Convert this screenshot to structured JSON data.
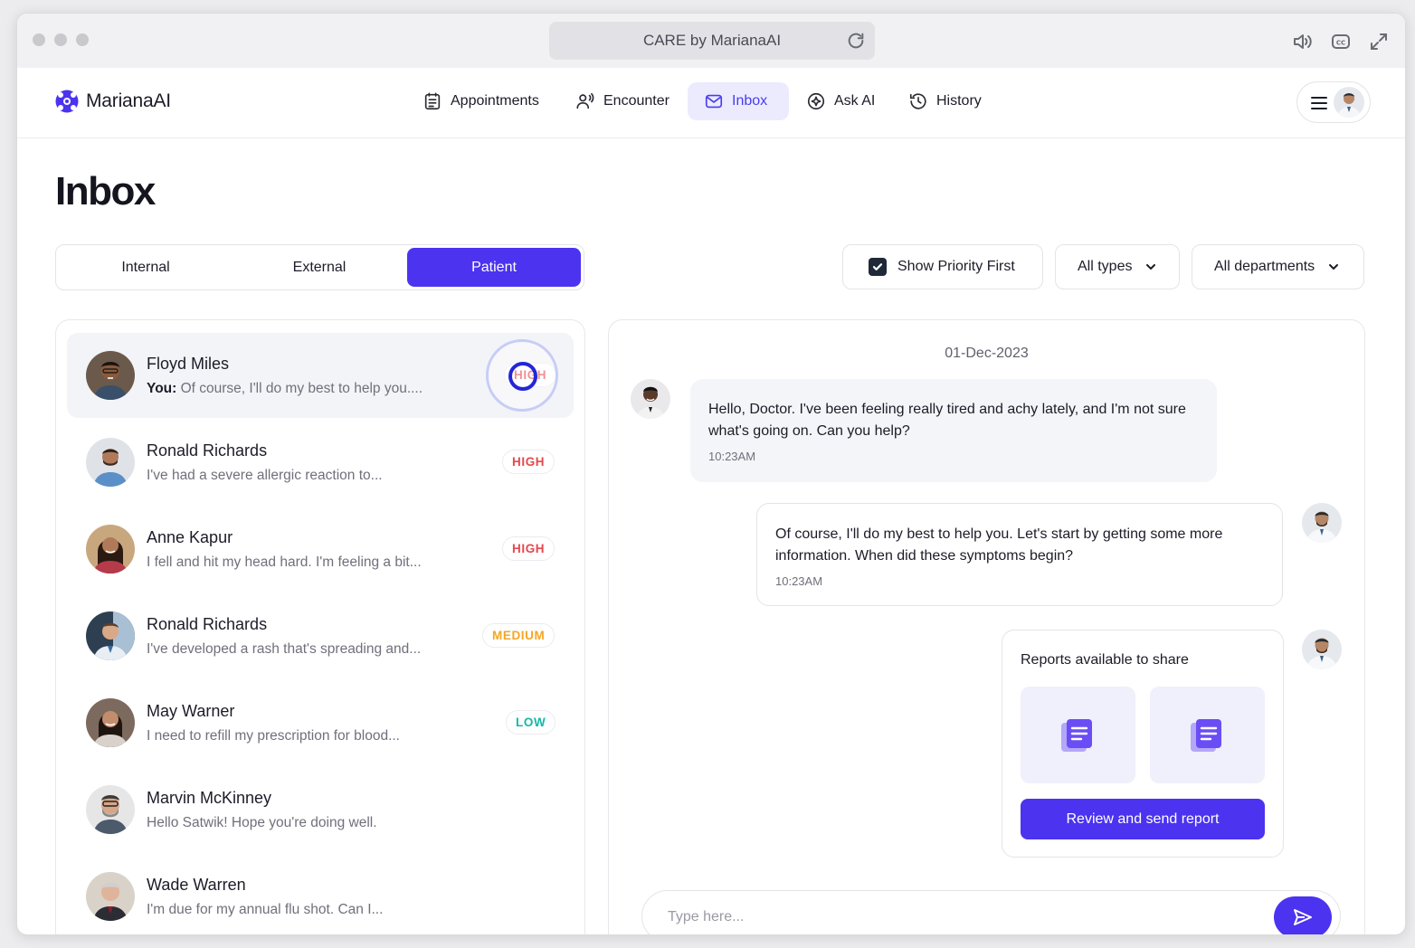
{
  "window": {
    "title": "CARE by MarianaAI"
  },
  "brand": {
    "name": "MarianaAI"
  },
  "nav": {
    "appointments": "Appointments",
    "encounter": "Encounter",
    "inbox": "Inbox",
    "ask_ai": "Ask AI",
    "history": "History"
  },
  "page": {
    "title": "Inbox"
  },
  "tabs": {
    "internal": "Internal",
    "external": "External",
    "patient": "Patient"
  },
  "filters": {
    "priority_label": "Show Priority First",
    "priority_checked": true,
    "types": "All types",
    "departments": "All departments"
  },
  "conversations": [
    {
      "name": "Floyd Miles",
      "prefix": "You:",
      "preview": " Of course, I'll do my best to help you....",
      "priority": "HIGH",
      "selected": true
    },
    {
      "name": "Ronald Richards",
      "prefix": "",
      "preview": "I've had a severe allergic reaction to...",
      "priority": "HIGH"
    },
    {
      "name": "Anne Kapur",
      "prefix": "",
      "preview": "I fell and hit my head hard. I'm feeling a bit...",
      "priority": "HIGH"
    },
    {
      "name": "Ronald Richards",
      "prefix": "",
      "preview": "I've developed a rash that's spreading and...",
      "priority": "MEDIUM"
    },
    {
      "name": "May Warner",
      "prefix": "",
      "preview": "I need to refill my prescription for blood...",
      "priority": "LOW"
    },
    {
      "name": "Marvin McKinney",
      "prefix": "",
      "preview": "Hello Satwik! Hope you're doing well.",
      "priority": ""
    },
    {
      "name": "Wade Warren",
      "prefix": "",
      "preview": "I'm due for my annual flu shot. Can I...",
      "priority": ""
    }
  ],
  "priority_colors": {
    "HIGH": "#e5484d",
    "MEDIUM": "#f5a623",
    "LOW": "#14b8a6"
  },
  "chat": {
    "date": "01-Dec-2023",
    "messages": [
      {
        "from": "patient",
        "text": "Hello, Doctor. I've been feeling really tired and achy lately, and I'm not sure what's going on. Can you help?",
        "time": "10:23AM"
      },
      {
        "from": "doctor",
        "text": "Of course, I'll do my best to help you. Let's start by getting some more information. When did these symptoms begin?",
        "time": "10:23AM"
      }
    ],
    "reports": {
      "title": "Reports available to share",
      "action": "Review and send report"
    },
    "input_placeholder": "Type here..."
  },
  "colors": {
    "accent": "#4b33f0",
    "accent_light": "#ebebfd"
  }
}
